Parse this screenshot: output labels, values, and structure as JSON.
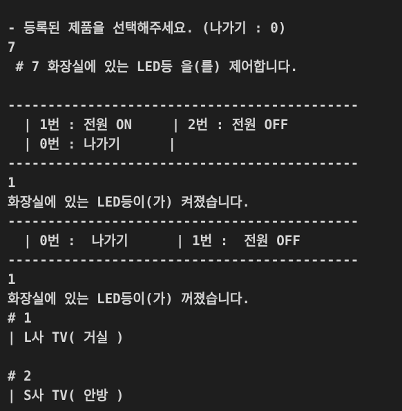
{
  "console": {
    "background": "#1e1e1e",
    "foreground": "#d4d4d4",
    "lines": [
      "- 등록된 제품을 선택해주세요. (나가기 : 0)",
      "7",
      " # 7 화장실에 있는 LED등 을(를) 제어합니다.",
      "",
      "--------------------------------------------",
      "  | 1번 : 전원 ON     | 2번 : 전원 OFF",
      "  | 0번 : 나가기      |",
      "--------------------------------------------",
      "1",
      "화장실에 있는 LED등이(가) 켜졌습니다.",
      "--------------------------------------------",
      "  | 0번 :  나가기      | 1번 :  전원 OFF",
      "--------------------------------------------",
      "1",
      "화장실에 있는 LED등이(가) 꺼졌습니다.",
      "# 1",
      "| L사 TV( 거실 )",
      "",
      "# 2",
      "| S사 TV( 안방 )"
    ]
  }
}
